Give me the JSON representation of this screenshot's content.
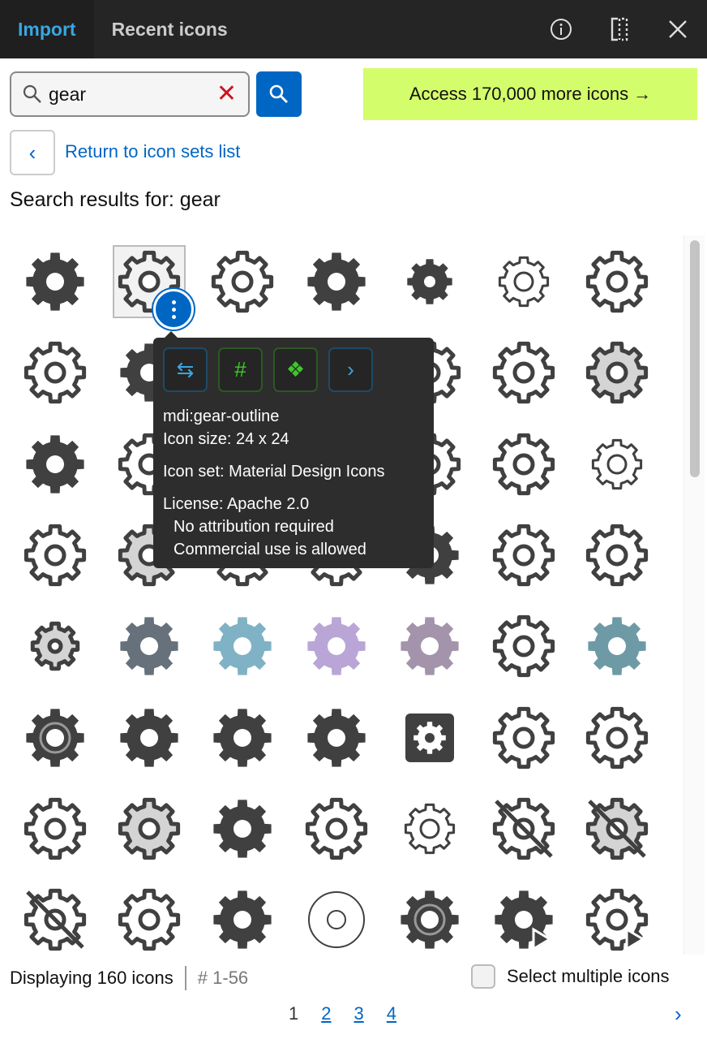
{
  "tabs": [
    {
      "label": "Import",
      "active": true
    },
    {
      "label": "Recent icons",
      "active": false
    }
  ],
  "toolbar_icons": [
    "info-icon",
    "split-view-icon",
    "close-icon"
  ],
  "search": {
    "value": "gear",
    "placeholder": "",
    "clear_icon": "x-icon",
    "button_icon": "search-icon"
  },
  "promo": {
    "label": "Access 170,000 more icons →"
  },
  "back": {
    "label": "Return to icon sets list"
  },
  "results_title": "Search results for: gear",
  "colors": {
    "accent": "#0066c4",
    "promo": "#d4fd6c",
    "icon": "#404040",
    "topbar": "#252525"
  },
  "icons": [
    "filled",
    "outline",
    "outline",
    "ring",
    "filled-small",
    "outline-thin",
    "outline",
    "outline",
    "filled",
    "outline",
    "outline",
    "outline",
    "outline",
    "grey-fill",
    "filled",
    "outline",
    "outline",
    "outline",
    "outline",
    "outline",
    "outline-thin",
    "outline",
    "grey-fill",
    "outline",
    "outline",
    "filled",
    "outline",
    "outline",
    "grey-fill-small",
    "slate",
    "teal",
    "lavender",
    "mauve",
    "outline",
    "teal-dark",
    "filled-ring",
    "ring",
    "filled",
    "filled",
    "square",
    "outline",
    "outline",
    "outline",
    "grey-fill",
    "filled",
    "outline",
    "outline-thin",
    "slashed",
    "slashed-grey",
    "slashed-outline",
    "outline",
    "filled",
    "circle-maze",
    "filled-ring",
    "play",
    "play-outline"
  ],
  "tooltip": {
    "actions": [
      "swap-arrows-icon",
      "hash-icon",
      "components-icon",
      "chevron-right-icon"
    ],
    "name": "mdi:gear-outline",
    "size": "Icon size: 24 x 24",
    "set": "Icon set: Material Design Icons",
    "license": "License: Apache 2.0",
    "attribution": "No attribution required",
    "commercial": "Commercial use is allowed"
  },
  "footer": {
    "count": "Displaying 160 icons",
    "range": "# 1-56",
    "multi_label": "Select multiple icons",
    "multi_checked": false
  },
  "pagination": {
    "current": "1",
    "pages": [
      "2",
      "3",
      "4"
    ],
    "next_icon": "chevron-right-icon"
  }
}
